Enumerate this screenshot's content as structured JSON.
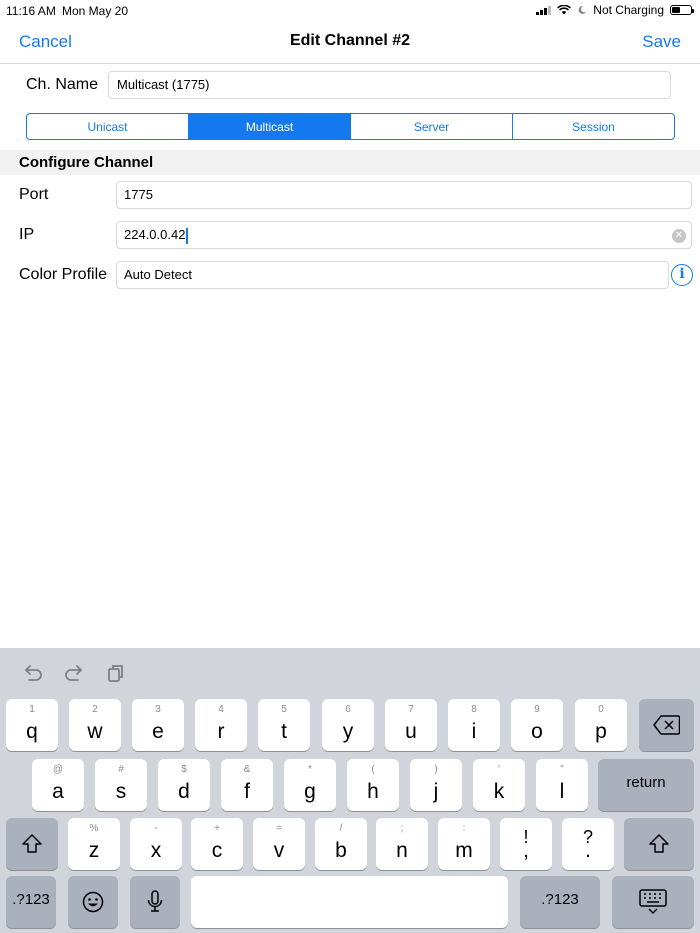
{
  "status": {
    "time": "11:16 AM",
    "date": "Mon May 20",
    "charging": "Not Charging",
    "battery_level": 0.45
  },
  "nav": {
    "cancel": "Cancel",
    "title": "Edit Channel #2",
    "save": "Save"
  },
  "channel": {
    "name_label": "Ch. Name",
    "name_value": "Multicast (1775)"
  },
  "segments": {
    "selected": "Multicast",
    "items": [
      "Unicast",
      "Multicast",
      "Server",
      "Session"
    ]
  },
  "section": {
    "title": "Configure Channel"
  },
  "fields": {
    "port_label": "Port",
    "port_value": "1775",
    "ip_label": "IP",
    "ip_value": "224.0.0.42",
    "color_label": "Color Profile",
    "color_value": "Auto Detect"
  },
  "keyboard": {
    "row1_hints": [
      "1",
      "2",
      "3",
      "4",
      "5",
      "6",
      "7",
      "8",
      "9",
      "0"
    ],
    "row1_keys": [
      "q",
      "w",
      "e",
      "r",
      "t",
      "y",
      "u",
      "i",
      "o",
      "p"
    ],
    "row2_hints": [
      "@",
      "#",
      "$",
      "&",
      "*",
      "(",
      ")",
      "'",
      "\""
    ],
    "row2_keys": [
      "a",
      "s",
      "d",
      "f",
      "g",
      "h",
      "j",
      "k",
      "l"
    ],
    "row3_hints": [
      "%",
      "-",
      "+",
      "=",
      "/",
      ";",
      ":",
      "!",
      "?"
    ],
    "row3_keys": [
      "z",
      "x",
      "c",
      "v",
      "b",
      "n",
      "m",
      ",",
      "."
    ],
    "return": "return",
    "numbers": ".?123"
  },
  "colors": {
    "accent": "#1479ef",
    "keyboard_bg": "#d1d4da",
    "dark_key": "#aab0bc"
  }
}
